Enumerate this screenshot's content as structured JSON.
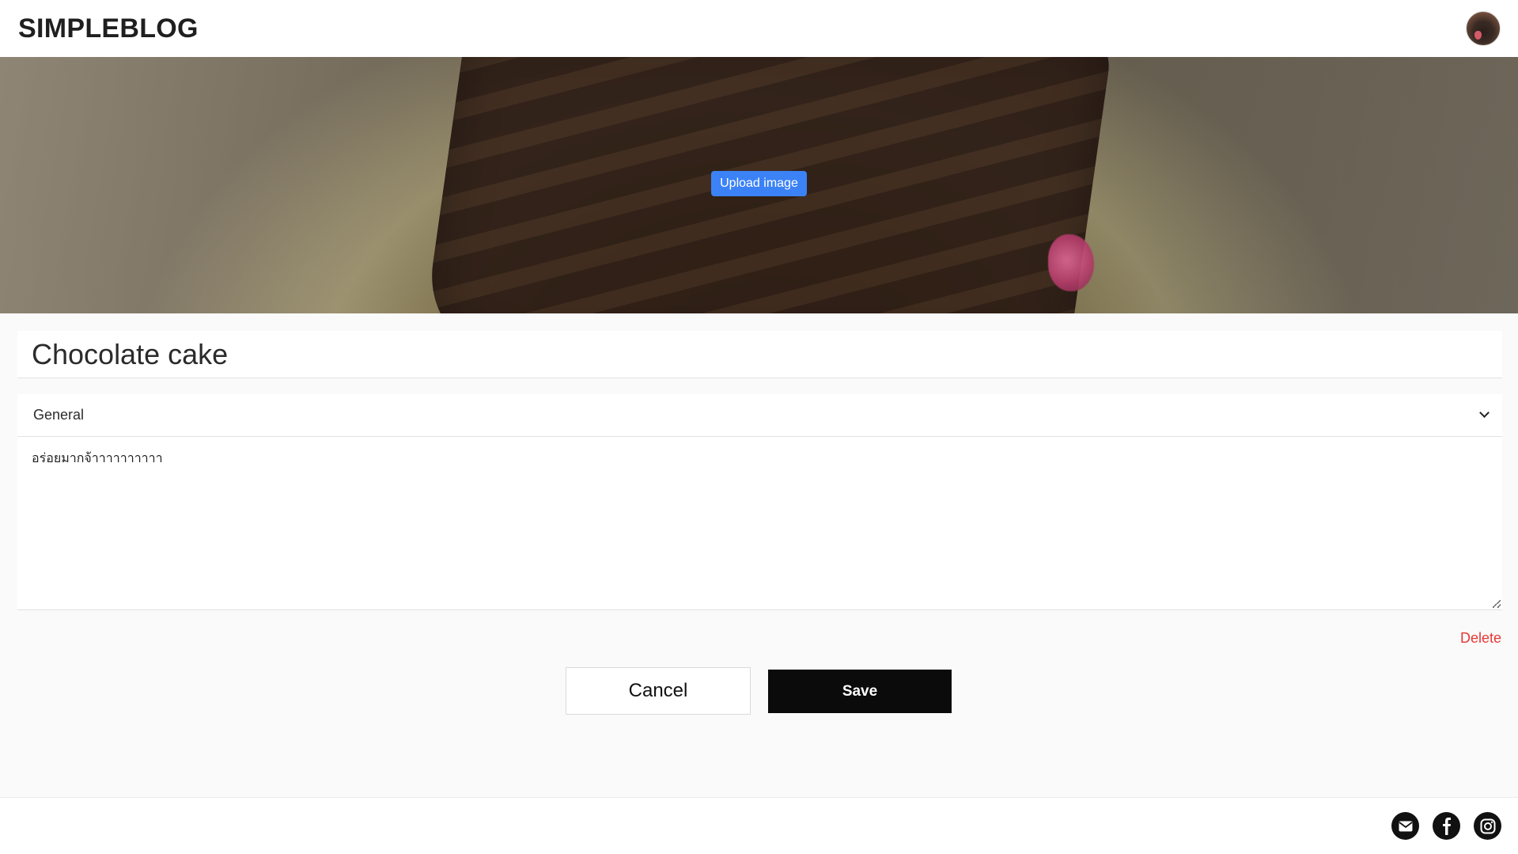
{
  "header": {
    "brand": "SIMPLEBLOG",
    "avatar": "user-avatar"
  },
  "hero": {
    "upload_label": "Upload image",
    "image": "chocolate-cake-photo"
  },
  "form": {
    "title_value": "Chocolate cake",
    "category_selected": "General",
    "content_value": "อร่อยมากจ้าาาาาาาาาา",
    "delete_label": "Delete",
    "cancel_label": "Cancel",
    "save_label": "Save"
  },
  "footer": {
    "icons": [
      "email-icon",
      "facebook-icon",
      "instagram-icon"
    ]
  },
  "colors": {
    "primary": "#3b82f6",
    "delete": "#e53935",
    "save_bg": "#0b0b0b"
  }
}
